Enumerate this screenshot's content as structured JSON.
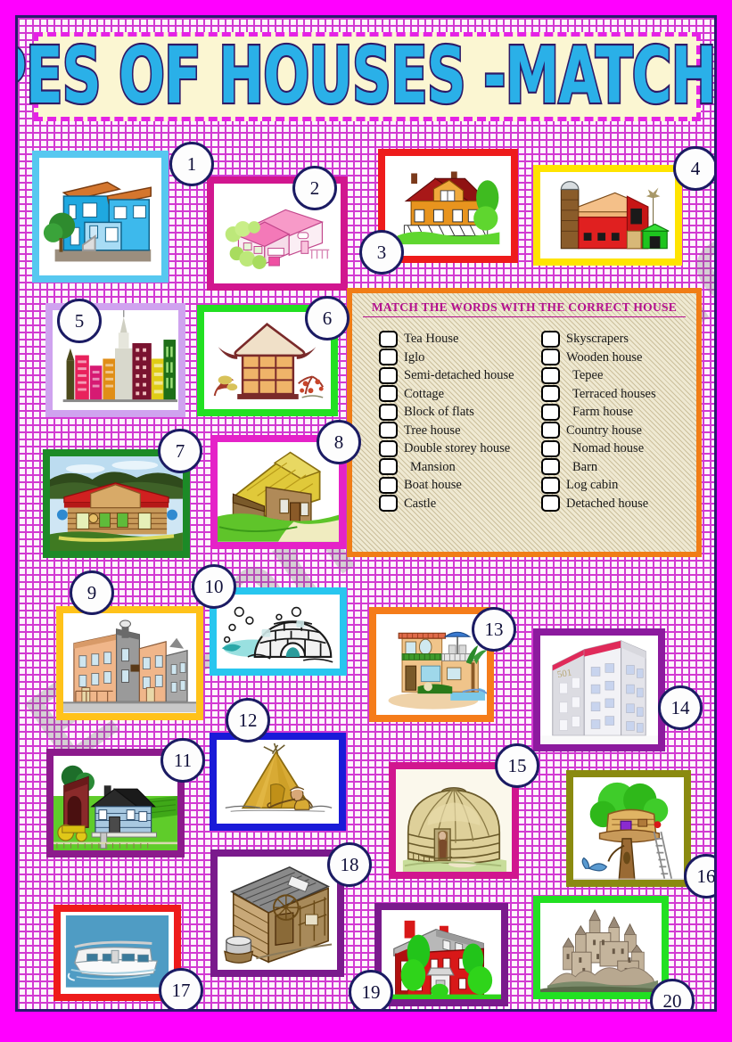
{
  "title": "TYPES OF HOUSES -MATCHING",
  "watermark": "ESLprintables.com",
  "wordbox": {
    "heading": "MATCH THE WORDS WITH THE CORRECT HOUSE",
    "left_column": [
      "Tea House",
      "Iglo",
      "Semi-detached house",
      "Cottage",
      "Block of flats",
      "Tree house",
      "Double storey house",
      "Mansion",
      "Boat house",
      "Castle"
    ],
    "right_column": [
      "Skyscrapers",
      "Wooden house",
      "Tepee",
      "Terraced houses",
      "Farm house",
      "Country house",
      "Nomad house",
      "Barn",
      "Log cabin",
      "Detached house"
    ]
  },
  "pictures": [
    {
      "n": "1",
      "subject": "double-storey-blue-house",
      "border": "#57c8f0"
    },
    {
      "n": "2",
      "subject": "pink-detached-house",
      "border": "#d1168f"
    },
    {
      "n": "3",
      "subject": "country-house",
      "border": "#ee1b1b"
    },
    {
      "n": "4",
      "subject": "red-barn",
      "border": "#ffe400"
    },
    {
      "n": "5",
      "subject": "skyscrapers",
      "border": "#cfa3ef"
    },
    {
      "n": "6",
      "subject": "tea-house-pagoda",
      "border": "#22e022"
    },
    {
      "n": "7",
      "subject": "log-cabin",
      "border": "#1c8a27"
    },
    {
      "n": "8",
      "subject": "thatched-cottage",
      "border": "#e522c8"
    },
    {
      "n": "9",
      "subject": "terraced-houses",
      "border": "#ffc21a"
    },
    {
      "n": "10",
      "subject": "igloo",
      "border": "#28c6ef"
    },
    {
      "n": "11",
      "subject": "farm-house",
      "border": "#8c1a8c"
    },
    {
      "n": "12",
      "subject": "tepee",
      "border": "#1a1ad8"
    },
    {
      "n": "13",
      "subject": "semi-detached-villa",
      "border": "#f57c1a"
    },
    {
      "n": "14",
      "subject": "block-of-flats",
      "border": "#8c1a9e"
    },
    {
      "n": "15",
      "subject": "nomad-yurt",
      "border": "#d1168f"
    },
    {
      "n": "16",
      "subject": "tree-house",
      "border": "#8a8a10"
    },
    {
      "n": "17",
      "subject": "boat-house",
      "border": "#ee1b1b"
    },
    {
      "n": "18",
      "subject": "wooden-house",
      "border": "#7a1a8c"
    },
    {
      "n": "19",
      "subject": "mansion",
      "border": "#7a1a8c"
    },
    {
      "n": "20",
      "subject": "castle",
      "border": "#22e022"
    }
  ],
  "flat_number_label": "501"
}
